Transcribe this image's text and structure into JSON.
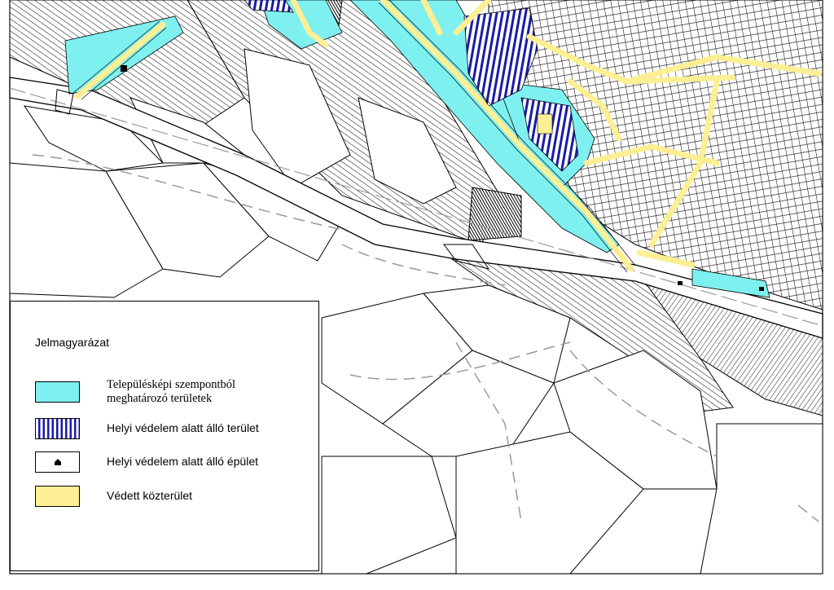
{
  "legend": {
    "title": "Jelmagyarázat",
    "items": [
      {
        "label_line1": "Településképi szempontból",
        "label_line2": "meghatározó területek",
        "swatch": "cyan",
        "fill": "#7ff0f0"
      },
      {
        "label": "Helyi védelem alatt álló terület",
        "swatch": "blue-vertical-hatch",
        "fill": "#1a1aa8"
      },
      {
        "label": "Helyi védelem alatt álló épület",
        "swatch": "building-icon",
        "fill": "#000000"
      },
      {
        "label": "Védett közterület",
        "swatch": "yellow",
        "fill": "#fcef94"
      }
    ]
  },
  "map_colors": {
    "significant_area": "#7ff0f0",
    "protected_area_hatch": "#1a1aa8",
    "protected_street": "#fcef94",
    "parcel_lines": "#000000",
    "dashed_lines": "#9a9a9a"
  }
}
